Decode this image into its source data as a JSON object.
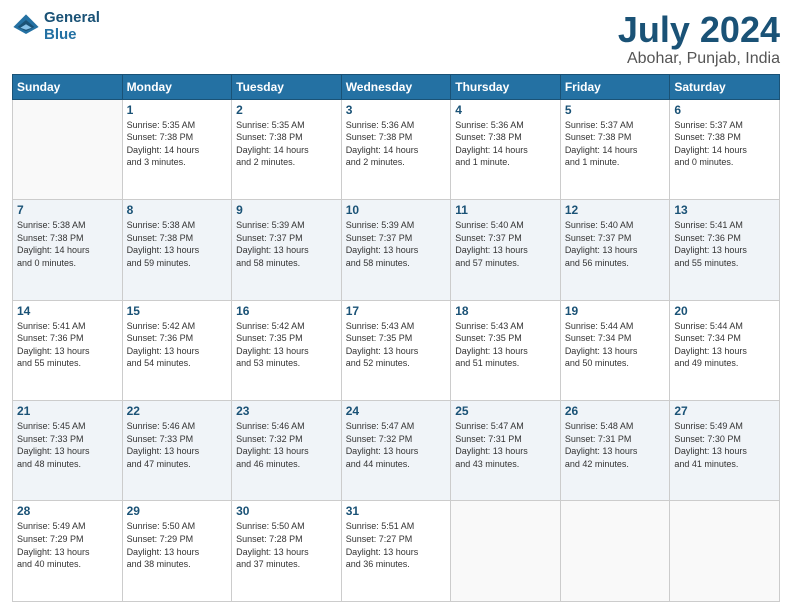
{
  "header": {
    "logo_line1": "General",
    "logo_line2": "Blue",
    "month": "July 2024",
    "location": "Abohar, Punjab, India"
  },
  "days_of_week": [
    "Sunday",
    "Monday",
    "Tuesday",
    "Wednesday",
    "Thursday",
    "Friday",
    "Saturday"
  ],
  "weeks": [
    [
      {
        "num": "",
        "info": ""
      },
      {
        "num": "1",
        "info": "Sunrise: 5:35 AM\nSunset: 7:38 PM\nDaylight: 14 hours\nand 3 minutes."
      },
      {
        "num": "2",
        "info": "Sunrise: 5:35 AM\nSunset: 7:38 PM\nDaylight: 14 hours\nand 2 minutes."
      },
      {
        "num": "3",
        "info": "Sunrise: 5:36 AM\nSunset: 7:38 PM\nDaylight: 14 hours\nand 2 minutes."
      },
      {
        "num": "4",
        "info": "Sunrise: 5:36 AM\nSunset: 7:38 PM\nDaylight: 14 hours\nand 1 minute."
      },
      {
        "num": "5",
        "info": "Sunrise: 5:37 AM\nSunset: 7:38 PM\nDaylight: 14 hours\nand 1 minute."
      },
      {
        "num": "6",
        "info": "Sunrise: 5:37 AM\nSunset: 7:38 PM\nDaylight: 14 hours\nand 0 minutes."
      }
    ],
    [
      {
        "num": "7",
        "info": "Sunrise: 5:38 AM\nSunset: 7:38 PM\nDaylight: 14 hours\nand 0 minutes."
      },
      {
        "num": "8",
        "info": "Sunrise: 5:38 AM\nSunset: 7:38 PM\nDaylight: 13 hours\nand 59 minutes."
      },
      {
        "num": "9",
        "info": "Sunrise: 5:39 AM\nSunset: 7:37 PM\nDaylight: 13 hours\nand 58 minutes."
      },
      {
        "num": "10",
        "info": "Sunrise: 5:39 AM\nSunset: 7:37 PM\nDaylight: 13 hours\nand 58 minutes."
      },
      {
        "num": "11",
        "info": "Sunrise: 5:40 AM\nSunset: 7:37 PM\nDaylight: 13 hours\nand 57 minutes."
      },
      {
        "num": "12",
        "info": "Sunrise: 5:40 AM\nSunset: 7:37 PM\nDaylight: 13 hours\nand 56 minutes."
      },
      {
        "num": "13",
        "info": "Sunrise: 5:41 AM\nSunset: 7:36 PM\nDaylight: 13 hours\nand 55 minutes."
      }
    ],
    [
      {
        "num": "14",
        "info": "Sunrise: 5:41 AM\nSunset: 7:36 PM\nDaylight: 13 hours\nand 55 minutes."
      },
      {
        "num": "15",
        "info": "Sunrise: 5:42 AM\nSunset: 7:36 PM\nDaylight: 13 hours\nand 54 minutes."
      },
      {
        "num": "16",
        "info": "Sunrise: 5:42 AM\nSunset: 7:35 PM\nDaylight: 13 hours\nand 53 minutes."
      },
      {
        "num": "17",
        "info": "Sunrise: 5:43 AM\nSunset: 7:35 PM\nDaylight: 13 hours\nand 52 minutes."
      },
      {
        "num": "18",
        "info": "Sunrise: 5:43 AM\nSunset: 7:35 PM\nDaylight: 13 hours\nand 51 minutes."
      },
      {
        "num": "19",
        "info": "Sunrise: 5:44 AM\nSunset: 7:34 PM\nDaylight: 13 hours\nand 50 minutes."
      },
      {
        "num": "20",
        "info": "Sunrise: 5:44 AM\nSunset: 7:34 PM\nDaylight: 13 hours\nand 49 minutes."
      }
    ],
    [
      {
        "num": "21",
        "info": "Sunrise: 5:45 AM\nSunset: 7:33 PM\nDaylight: 13 hours\nand 48 minutes."
      },
      {
        "num": "22",
        "info": "Sunrise: 5:46 AM\nSunset: 7:33 PM\nDaylight: 13 hours\nand 47 minutes."
      },
      {
        "num": "23",
        "info": "Sunrise: 5:46 AM\nSunset: 7:32 PM\nDaylight: 13 hours\nand 46 minutes."
      },
      {
        "num": "24",
        "info": "Sunrise: 5:47 AM\nSunset: 7:32 PM\nDaylight: 13 hours\nand 44 minutes."
      },
      {
        "num": "25",
        "info": "Sunrise: 5:47 AM\nSunset: 7:31 PM\nDaylight: 13 hours\nand 43 minutes."
      },
      {
        "num": "26",
        "info": "Sunrise: 5:48 AM\nSunset: 7:31 PM\nDaylight: 13 hours\nand 42 minutes."
      },
      {
        "num": "27",
        "info": "Sunrise: 5:49 AM\nSunset: 7:30 PM\nDaylight: 13 hours\nand 41 minutes."
      }
    ],
    [
      {
        "num": "28",
        "info": "Sunrise: 5:49 AM\nSunset: 7:29 PM\nDaylight: 13 hours\nand 40 minutes."
      },
      {
        "num": "29",
        "info": "Sunrise: 5:50 AM\nSunset: 7:29 PM\nDaylight: 13 hours\nand 38 minutes."
      },
      {
        "num": "30",
        "info": "Sunrise: 5:50 AM\nSunset: 7:28 PM\nDaylight: 13 hours\nand 37 minutes."
      },
      {
        "num": "31",
        "info": "Sunrise: 5:51 AM\nSunset: 7:27 PM\nDaylight: 13 hours\nand 36 minutes."
      },
      {
        "num": "",
        "info": ""
      },
      {
        "num": "",
        "info": ""
      },
      {
        "num": "",
        "info": ""
      }
    ]
  ]
}
